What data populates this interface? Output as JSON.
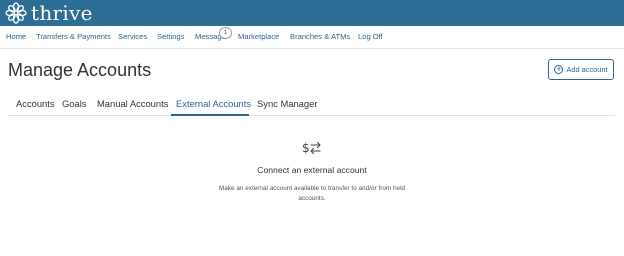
{
  "brand": {
    "name": "thrive",
    "bar_color": "#2d6f94"
  },
  "topnav": {
    "items": [
      "Home",
      "Transfers & Payments",
      "Services",
      "Settings",
      "Messages",
      "Marketplace",
      "Branches & ATMs",
      "Log Off"
    ],
    "message_badge": "1"
  },
  "page": {
    "title": "Manage Accounts"
  },
  "actions": {
    "add_account_label": "Add account"
  },
  "tabs": {
    "items": [
      "Accounts",
      "Goals",
      "Manual Accounts",
      "External Accounts",
      "Sync Manager"
    ],
    "active": "External Accounts"
  },
  "empty_state": {
    "icon": "transfer-dollar-icon",
    "title": "Connect an external account",
    "description": "Make an external account available to transfer to and/or from held accounts."
  },
  "colors": {
    "link": "#2a6496",
    "text": "#333333"
  }
}
